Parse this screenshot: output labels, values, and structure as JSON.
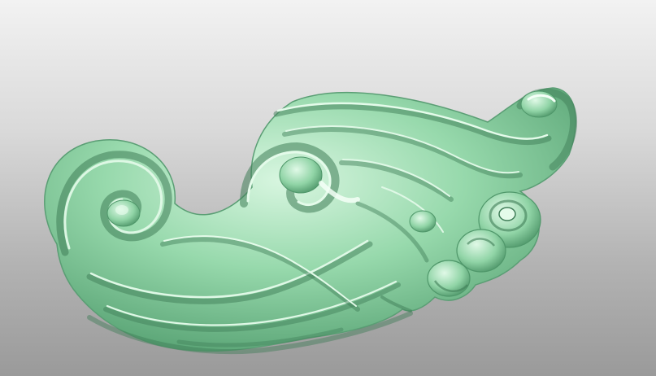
{
  "viewport": {
    "background_top": "#f2f2f2",
    "background_bottom": "#9a9a9a"
  },
  "model": {
    "icon": "carved-acanthus-scroll-relief",
    "material_color": "#8fd6a7",
    "shadow_color": "#3f7d57",
    "highlight_color": "#e4fbea"
  }
}
